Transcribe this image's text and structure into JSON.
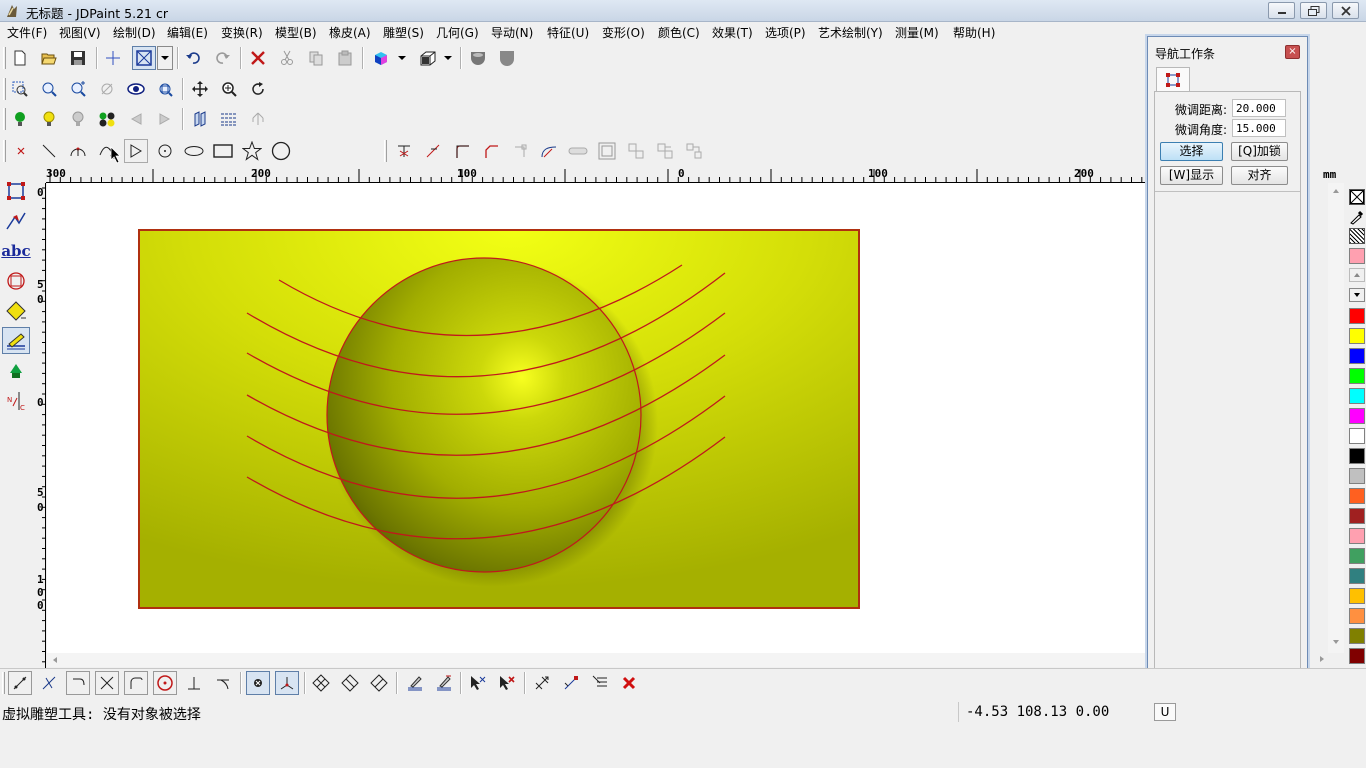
{
  "window": {
    "title": "无标题 - JDPaint 5.21 cr"
  },
  "menu": [
    "文件(F)",
    "视图(V)",
    "绘制(D)",
    "编辑(E)",
    "变换(R)",
    "模型(B)",
    "橡皮(A)",
    "雕塑(S)",
    "几何(G)",
    "导动(N)",
    "特征(U)",
    "变形(O)",
    "颜色(C)",
    "效果(T)",
    "选项(P)",
    "艺术绘制(Y)",
    "测量(M)",
    "帮助(H)"
  ],
  "ruler": {
    "unit": "mm",
    "h_labels": [
      "300",
      "200",
      "100",
      "0",
      "100",
      "200"
    ],
    "v_labels": [
      "0",
      "5\n0",
      "0",
      "5\n0",
      "1\n0\n0"
    ]
  },
  "nav_panel": {
    "title": "导航工作条",
    "close": "×",
    "fine_distance_label": "微调距离:",
    "fine_distance_value": "20.000",
    "fine_angle_label": "微调角度:",
    "fine_angle_value": "15.000",
    "select_btn": "选择",
    "lock_btn": "[Q]加锁",
    "show_btn": "[W]显示",
    "align_btn": "对齐"
  },
  "status": {
    "message": "虚拟雕塑工具: 没有对象被选择",
    "coords": "-4.53 108.13 0.00",
    "indicator": "U"
  },
  "left_tools": {
    "text_tool": "abc"
  },
  "colors": {
    "relief_light": "#f0ff10",
    "relief_dark": "#8e9c00",
    "curve": "#c0181c",
    "palette": [
      "#ff0000",
      "#ffff00",
      "#0000ff",
      "#00ff00",
      "#00ffff",
      "#ff00ff",
      "#ffffff",
      "#000000",
      "#c0c0c0",
      "#ff6020",
      "#a02020",
      "#ffa0b0",
      "#40a060",
      "#308080",
      "#ffc000",
      "#ff9040",
      "#808000",
      "#800000"
    ]
  }
}
